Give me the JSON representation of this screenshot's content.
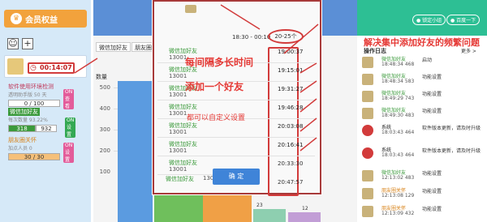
{
  "left": {
    "title": "会员权益",
    "add_label": "+",
    "timer": "00:14:07",
    "sections": [
      {
        "title": "软件使用环境检测",
        "sub": "透明助手版 50 天",
        "tag": "ON 查看",
        "progress": "0 / 100"
      },
      {
        "title": "微信加好友",
        "sub": "每次数量 93.22%",
        "tag": "ON 设置",
        "progress": "318",
        "progress2": "932"
      },
      {
        "title": "朋友圈关怀",
        "sub": "加点人员 0",
        "tag": "ON 设置",
        "progress": "30 / 30"
      }
    ]
  },
  "middle": {
    "tabs": [
      "微信加好友",
      "朋友圈"
    ],
    "y_label": "数量",
    "y_ticks": [
      "500",
      "400",
      "300",
      "200",
      "100"
    ],
    "bottom_values": [
      "23",
      "12"
    ]
  },
  "dialog": {
    "header_time": "18:30 - 00:10",
    "header_range": "20-25个",
    "rows": [
      {
        "name": "微信加好友",
        "id": "13001",
        "time": "19:00:37"
      },
      {
        "name": "微信加好友",
        "id": "13001",
        "time": "19:15:01"
      },
      {
        "name": "微信加好友",
        "id": "13001",
        "time": "19:31:27"
      },
      {
        "name": "微信加好友",
        "id": "13001",
        "time": "19:46:28"
      },
      {
        "name": "微信加好友",
        "id": "13001",
        "time": "20:03:08"
      },
      {
        "name": "微信加好友",
        "id": "13001",
        "time": "20:16:41"
      },
      {
        "name": "微信加好友",
        "id": "13001",
        "time": "20:33:30"
      },
      {
        "name": "微信加好友",
        "id": "13001",
        "time": "20:47:57"
      }
    ],
    "caption_1": "每间隔多长时间",
    "caption_2": "添加一个好友",
    "caption_3": "都可以自定义设置",
    "confirm": "确 定"
  },
  "right": {
    "pill_1": "● 锁定小组",
    "pill_2": "● 百度一下",
    "heading": "解决集中添加好友的频繁问题",
    "log_title": "操作日志",
    "more": "更多 >",
    "logs": [
      {
        "name": "微信加好友",
        "time": "18:48:34 468",
        "msg": "启动"
      },
      {
        "name": "微信加好友",
        "time": "18:48:34 583",
        "msg": "功能设置"
      },
      {
        "name": "微信加好友",
        "time": "18:49:29 743",
        "msg": "功能设置"
      },
      {
        "name": "微信加好友",
        "time": "18:49:30 483",
        "msg": "功能设置"
      },
      {
        "name": "系统",
        "time": "18:03:43 464",
        "msg": "软件版本更新，请及时升级"
      },
      {
        "name": "系统",
        "time": "18:03:43 464",
        "msg": "软件版本更新，请及时升级"
      },
      {
        "name": "微信加好友",
        "time": "12:13:02 483",
        "msg": "功能设置"
      },
      {
        "name": "朋友圈关怀",
        "time": "12:13:08 129",
        "msg": "功能设置"
      },
      {
        "name": "朋友圈关怀",
        "time": "12:13:09 432",
        "msg": "功能设置"
      }
    ]
  }
}
